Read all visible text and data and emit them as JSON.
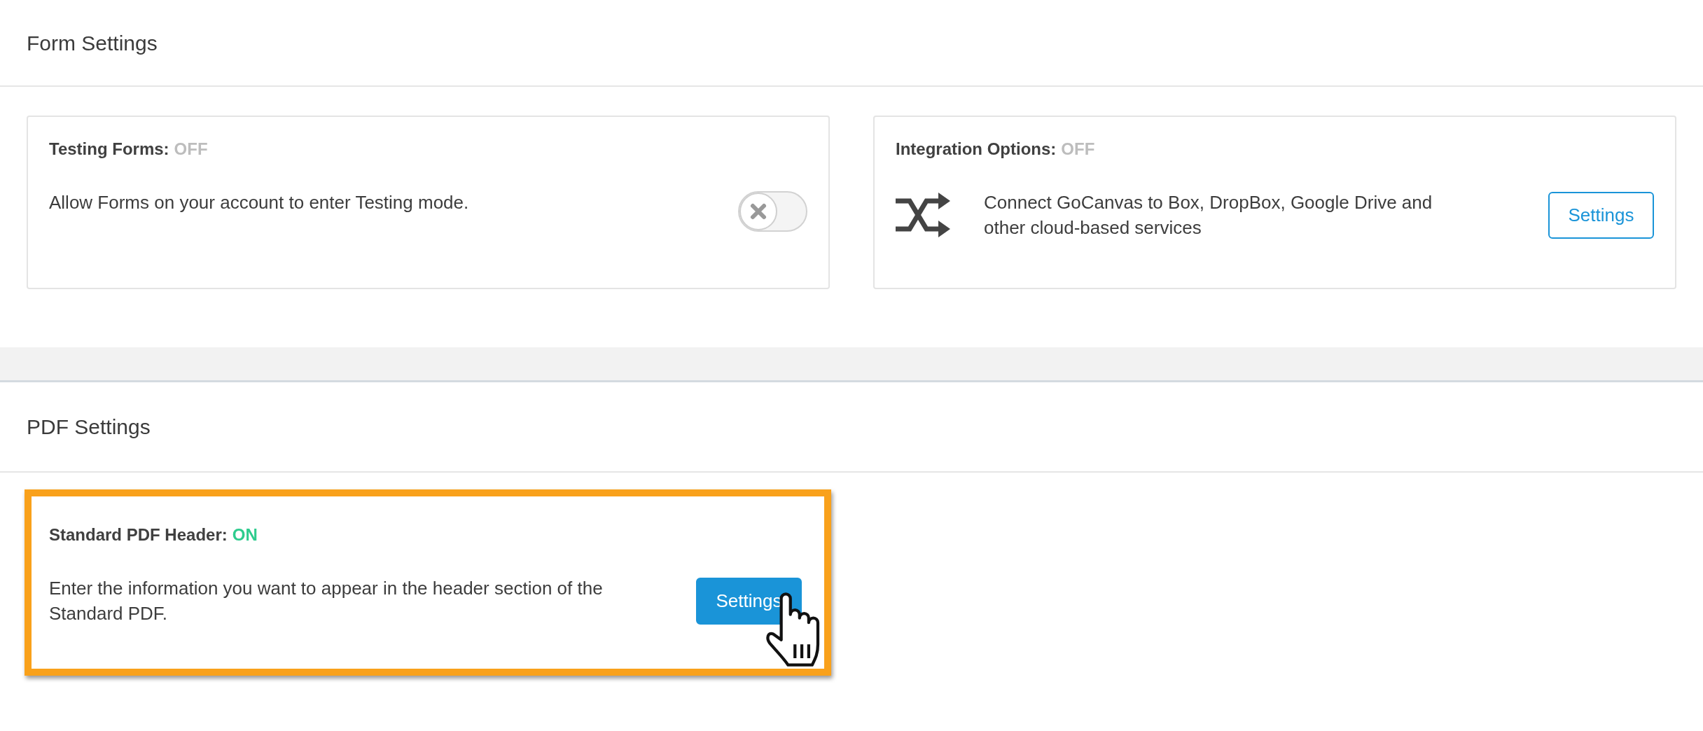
{
  "sections": [
    {
      "title": "Form Settings",
      "cards": [
        {
          "kind": "toggle",
          "title": "Testing Forms:",
          "status": "OFF",
          "enabled": false,
          "highlighted": false,
          "description": "Allow Forms on your account to enter Testing mode."
        },
        {
          "kind": "integration",
          "title": "Integration Options:",
          "status": "OFF",
          "enabled": false,
          "highlighted": false,
          "description": "Connect GoCanvas to Box, DropBox, Google Drive and other cloud-based services",
          "button": {
            "label": "Settings",
            "hovered": false
          }
        }
      ]
    },
    {
      "title": "PDF Settings",
      "cards": [
        {
          "kind": "action",
          "title": "Standard PDF Header:",
          "status": "ON",
          "enabled": true,
          "highlighted": true,
          "description": "Enter the information you want to appear in the header section of the Standard PDF.",
          "button": {
            "label": "Settings",
            "hovered": true
          }
        }
      ]
    }
  ]
}
